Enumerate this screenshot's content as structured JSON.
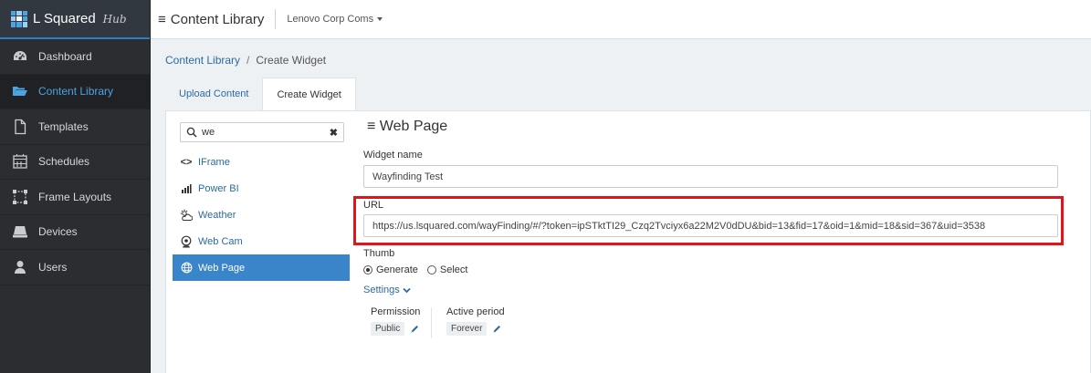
{
  "brand": {
    "name": "L Squared",
    "sub": "Hub"
  },
  "nav": [
    {
      "label": "Dashboard",
      "icon": "dashboard-gauge-icon"
    },
    {
      "label": "Content Library",
      "icon": "folder-open-icon",
      "active": true
    },
    {
      "label": "Templates",
      "icon": "file-icon"
    },
    {
      "label": "Schedules",
      "icon": "calendar-icon"
    },
    {
      "label": "Frame Layouts",
      "icon": "frame-layout-icon"
    },
    {
      "label": "Devices",
      "icon": "device-icon"
    },
    {
      "label": "Users",
      "icon": "user-icon"
    }
  ],
  "topbar": {
    "title": "Content Library",
    "org": "Lenovo Corp Coms"
  },
  "breadcrumb": {
    "parent": "Content Library",
    "separator": "/",
    "current": "Create Widget"
  },
  "tabs": [
    {
      "label": "Upload Content"
    },
    {
      "label": "Create Widget",
      "active": true
    }
  ],
  "widget_search": {
    "value": "we",
    "clear": "✖"
  },
  "widgets": [
    {
      "label": "IFrame",
      "icon": "code-icon",
      "glyph": "<>"
    },
    {
      "label": "Power BI",
      "icon": "bar-chart-icon"
    },
    {
      "label": "Weather",
      "icon": "weather-icon"
    },
    {
      "label": "Web Cam",
      "icon": "webcam-icon"
    },
    {
      "label": "Web Page",
      "icon": "globe-icon",
      "active": true
    }
  ],
  "form": {
    "title": "Web Page",
    "widget_name_label": "Widget name",
    "widget_name_value": "Wayfinding Test",
    "url_label": "URL",
    "url_value": "https://us.lsquared.com/wayFinding/#/?token=ipSTktTI29_Czq2Tvciyx6a22M2V0dDU&bid=13&fid=17&oid=1&mid=18&sid=367&uid=3538",
    "thumb_label": "Thumb",
    "thumb_options": [
      {
        "label": "Generate",
        "selected": true
      },
      {
        "label": "Select",
        "selected": false
      }
    ],
    "settings_label": "Settings",
    "permission_label": "Permission",
    "permission_value": "Public",
    "active_period_label": "Active period",
    "active_period_value": "Forever"
  },
  "colors": {
    "accent": "#3a84c9",
    "highlight": "#e0141a",
    "sidebar": "#2b2d30"
  }
}
